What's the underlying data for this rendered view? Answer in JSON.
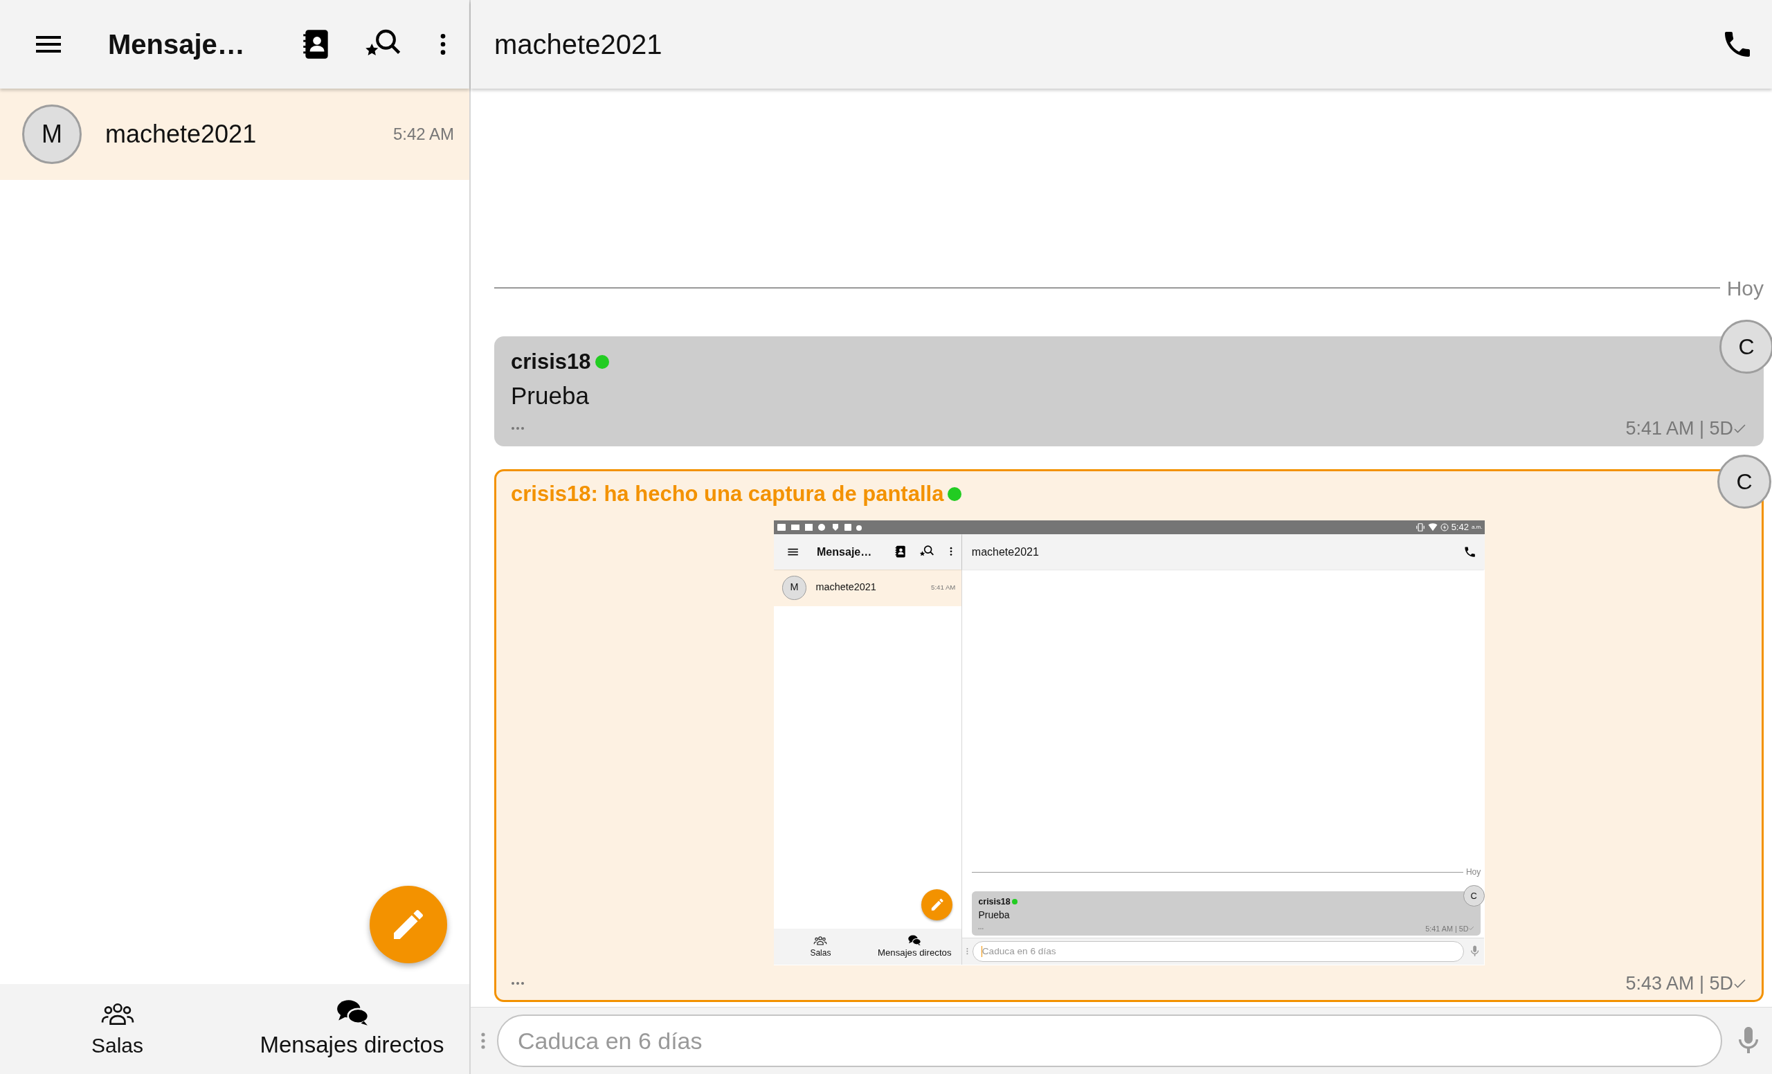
{
  "sidebar": {
    "title": "Mensaje…",
    "conversations": [
      {
        "avatar": "M",
        "name": "machete2021",
        "time": "5:42 AM",
        "selected": true
      }
    ],
    "nav": [
      {
        "kind": "rooms",
        "label": "Salas"
      },
      {
        "kind": "direct",
        "label": "Mensajes directos"
      }
    ]
  },
  "chat": {
    "title": "machete2021",
    "divider": "Hoy",
    "messages": [
      {
        "kind": "text",
        "avatar": "C",
        "sender": "crisis18",
        "online": true,
        "text": "Prueba",
        "time": "5:41 AM | 5D",
        "delivered": true
      },
      {
        "kind": "screenshot",
        "avatar": "C",
        "sender": "crisis18: ha hecho una captura de pantalla",
        "online": true,
        "time": "5:43 AM | 5D",
        "delivered": true,
        "screenshot": {
          "status_bar": {
            "time": "5:42",
            "suffix": "a.m."
          },
          "sidebar": {
            "title": "Mensaje…",
            "conversations": [
              {
                "avatar": "M",
                "name": "machete2021",
                "time": "5:41 AM",
                "selected": true
              }
            ],
            "nav": [
              {
                "kind": "rooms",
                "label": "Salas"
              },
              {
                "kind": "direct",
                "label": "Mensajes directos"
              }
            ]
          },
          "chat": {
            "title": "machete2021",
            "divider": "Hoy",
            "messages": [
              {
                "kind": "text",
                "avatar": "C",
                "sender": "crisis18",
                "online": true,
                "text": "Prueba",
                "time": "5:41 AM | 5D",
                "delivered": true
              }
            ],
            "input": {
              "placeholder": "Caduca en 6 días",
              "focused": true
            }
          }
        }
      }
    ],
    "input": {
      "placeholder": "Caduca en 6 días",
      "focused": false
    }
  }
}
